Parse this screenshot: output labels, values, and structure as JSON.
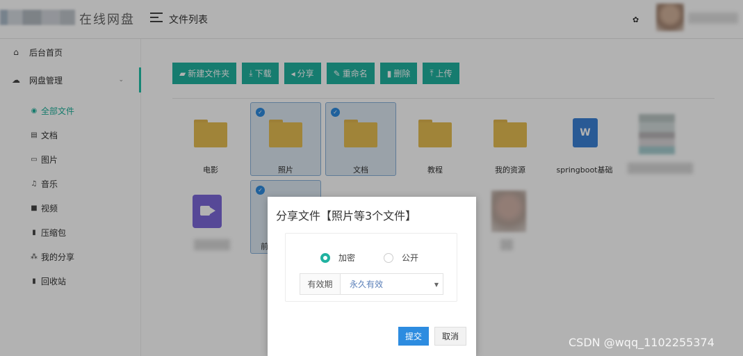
{
  "header": {
    "logo_text": "在线网盘",
    "page_title": "文件列表"
  },
  "sidebar": {
    "items": [
      {
        "label": "后台首页",
        "icon": "home-icon"
      },
      {
        "label": "网盘管理",
        "icon": "cloud-icon"
      }
    ],
    "sub_items": [
      {
        "label": "全部文件",
        "icon": "eye-icon"
      },
      {
        "label": "文档",
        "icon": "document-icon"
      },
      {
        "label": "图片",
        "icon": "image-icon"
      },
      {
        "label": "音乐",
        "icon": "music-icon"
      },
      {
        "label": "视频",
        "icon": "video-icon"
      },
      {
        "label": "压缩包",
        "icon": "archive-icon"
      },
      {
        "label": "我的分享",
        "icon": "share-icon"
      },
      {
        "label": "回收站",
        "icon": "recycle-icon"
      }
    ]
  },
  "toolbar": {
    "buttons": [
      {
        "label": "新建文件夹",
        "icon": "folder-plus-icon"
      },
      {
        "label": "下载",
        "icon": "download-icon"
      },
      {
        "label": "分享",
        "icon": "send-icon"
      },
      {
        "label": "重命名",
        "icon": "pencil-icon"
      },
      {
        "label": "删除",
        "icon": "trash-icon"
      },
      {
        "label": "上传",
        "icon": "upload-icon"
      }
    ]
  },
  "files": [
    {
      "name": "电影",
      "type": "folder",
      "selected": false
    },
    {
      "name": "照片",
      "type": "folder",
      "selected": true
    },
    {
      "name": "文档",
      "type": "folder",
      "selected": true
    },
    {
      "name": "教程",
      "type": "folder",
      "selected": false
    },
    {
      "name": "我的资源",
      "type": "folder",
      "selected": false
    },
    {
      "name": "springboot基础",
      "type": "word",
      "selected": false
    },
    {
      "name": "前",
      "type": "image",
      "selected": true
    }
  ],
  "dialog": {
    "title": "分享文件【照片等3个文件】",
    "radio_encrypted": "加密",
    "radio_public": "公开",
    "selected_radio": "加密",
    "validity_label": "有效期",
    "validity_value": "永久有效",
    "submit_label": "提交",
    "cancel_label": "取消"
  },
  "watermark": "CSDN @wqq_1102255374",
  "colors": {
    "accent": "#20b2a0",
    "primary_button": "#2d8ce0",
    "folder": "#e6bd52"
  }
}
